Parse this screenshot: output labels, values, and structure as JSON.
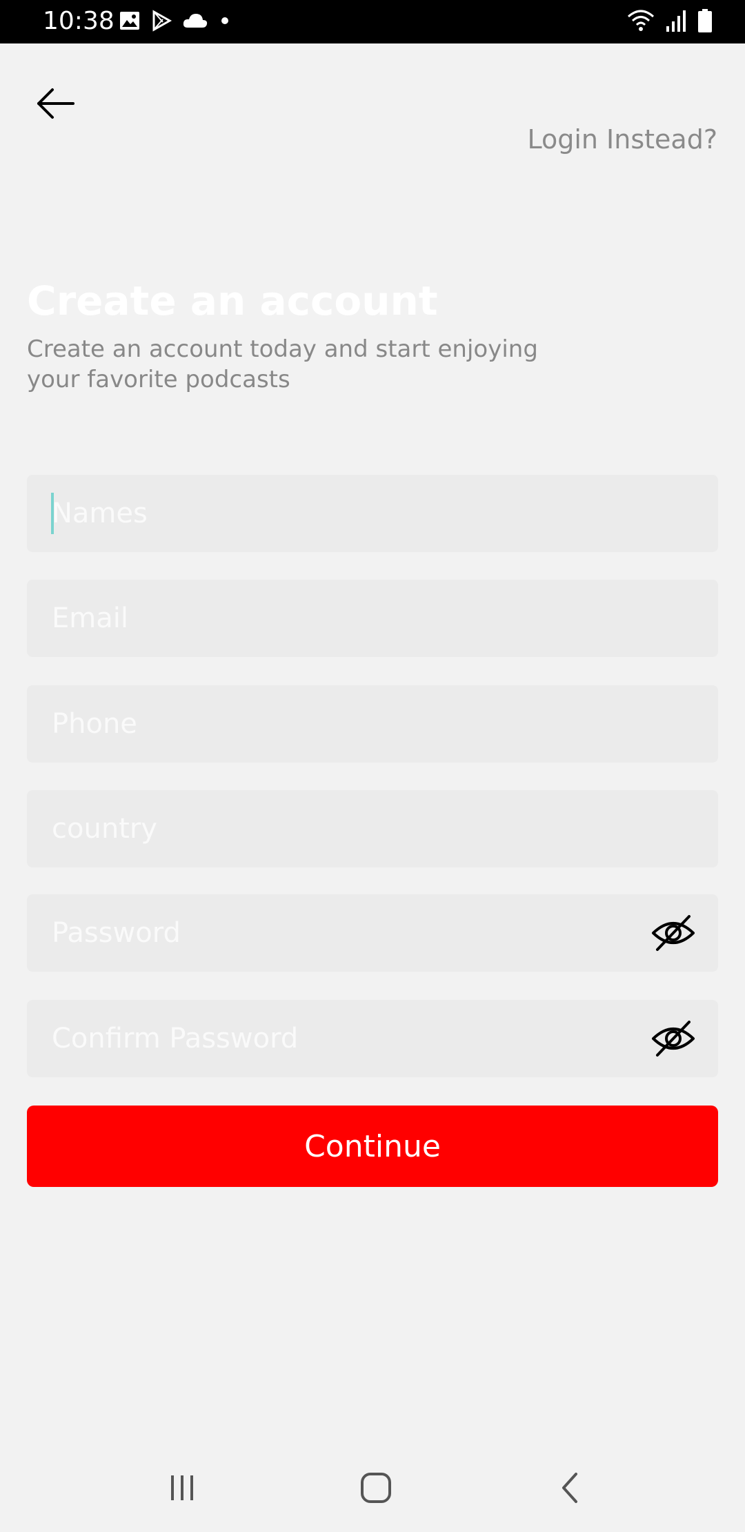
{
  "status_bar": {
    "time": "10:38",
    "left_icons": [
      "image-icon",
      "play-store-icon",
      "cloud-icon",
      "dot-icon"
    ],
    "right_icons": [
      "wifi-icon",
      "signal-icon",
      "battery-icon"
    ]
  },
  "header": {
    "back_icon": "arrow-left-icon",
    "login_link": "Login Instead?"
  },
  "intro": {
    "title": "Create an account",
    "subtitle": "Create an account today and start enjoying your favorite podcasts"
  },
  "form": {
    "names_placeholder": "Names",
    "email_placeholder": "Email",
    "phone_placeholder": "Phone",
    "country_placeholder": "country",
    "password_placeholder": "Password",
    "confirm_password_placeholder": "Confirm Password",
    "visibility_icon": "eye-off-icon",
    "continue_label": "Continue"
  },
  "nav_bar": {
    "items": [
      "recent-apps-icon",
      "home-icon",
      "back-icon"
    ]
  },
  "colors": {
    "background": "#f2f2f2",
    "field_background": "#ebebeb",
    "primary_button": "#ff0000",
    "cursor": "#7ad3cf",
    "muted_text": "#888888"
  }
}
